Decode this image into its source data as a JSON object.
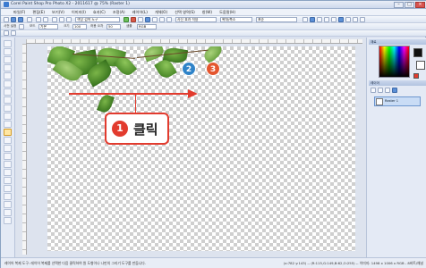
{
  "window": {
    "title": "Corel Paint Shop Pro Photo X2 - 2011617 @ 75% (Raster 1)"
  },
  "menu": [
    "파일(F)",
    "편집(E)",
    "보기(V)",
    "이미지(I)",
    "효과(C)",
    "조정(A)",
    "레이어(L)",
    "개체(O)",
    "선택 영역(S)",
    "창(W)",
    "도움말(H)"
  ],
  "toolbar": {
    "mode_dropdown": "색상 검색 도구",
    "tool_dropdown": "사진 효과 적용",
    "zoom_dropdown": "확대/축소",
    "view_dropdown": "표준"
  },
  "tool_options": {
    "preset_label": "사전 설정",
    "mode_label": "모드",
    "mode_value": "기본",
    "size_label": "크기",
    "size_value": "100",
    "tolerance_label": "허용 오차",
    "tolerance_value": "50",
    "sample_label": "샘플",
    "sample_value": "RGB"
  },
  "annotations": {
    "step1_number": "1",
    "step1_label": "클릭",
    "step2_number": "2",
    "step3_number": "3"
  },
  "panels": {
    "materials_title": "재료",
    "layers_title": "레이어",
    "layer_name": "Raster 1"
  },
  "status": {
    "left": "레이어 복제 도구: 레이어 복제를 선택한 다음 클릭하여 원 도형이나 나만의 그리기 도구를 만듭니다.",
    "right": "(x:782 y:143) -- (R:115,G:149,B:62,O:255) -- 이미지: 1498 x 1006 x RGB - 8비트/채널"
  },
  "colors": {
    "accent_red": "#e23b2e",
    "badge_blue": "#2f83c8",
    "badge_orange": "#e4562f"
  }
}
